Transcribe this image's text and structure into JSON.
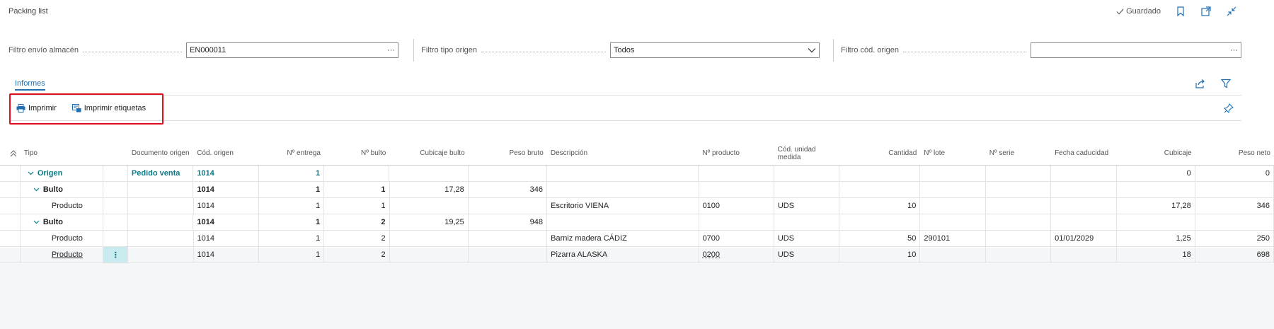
{
  "page": {
    "title": "Packing list",
    "saved_label": "Guardado"
  },
  "filters": [
    {
      "label": "Filtro envío almacén",
      "value": "EN000011",
      "kind": "lookup"
    },
    {
      "label": "Filtro tipo origen",
      "value": "Todos",
      "kind": "select"
    },
    {
      "label": "Filtro cód. origen",
      "value": "",
      "kind": "lookup"
    }
  ],
  "tabs": {
    "informes": "Informes"
  },
  "actions": {
    "print": "Imprimir",
    "print_labels": "Imprimir etiquetas"
  },
  "table": {
    "columns": [
      "Tipo",
      "Documento origen",
      "Cód. origen",
      "Nº entrega",
      "Nº bulto",
      "Cubicaje bulto",
      "Peso bruto",
      "Descripción",
      "Nº producto",
      "Cód. unidad medida",
      "Cantidad",
      "Nº lote",
      "Nº serie",
      "Fecha caducidad",
      "Cubicaje",
      "Peso neto"
    ],
    "rows": [
      {
        "level": 0,
        "tipo": "Origen",
        "doc": "Pedido venta",
        "cod": "1014",
        "entrega": "1",
        "bulto": "",
        "cub_bulto": "",
        "peso_bruto": "",
        "desc": "",
        "producto": "",
        "unidad": "",
        "cantidad": "",
        "lote": "",
        "serie": "",
        "caducidad": "",
        "cubicaje": "0",
        "peso_neto": "0"
      },
      {
        "level": 1,
        "tipo": "Bulto",
        "doc": "",
        "cod": "1014",
        "entrega": "1",
        "bulto": "1",
        "cub_bulto": "17,28",
        "peso_bruto": "346",
        "desc": "",
        "producto": "",
        "unidad": "",
        "cantidad": "",
        "lote": "",
        "serie": "",
        "caducidad": "",
        "cubicaje": "",
        "peso_neto": ""
      },
      {
        "level": 2,
        "tipo": "Producto",
        "doc": "",
        "cod": "1014",
        "entrega": "1",
        "bulto": "1",
        "cub_bulto": "",
        "peso_bruto": "",
        "desc": "Escritorio VIENA",
        "producto": "0100",
        "unidad": "UDS",
        "cantidad": "10",
        "lote": "",
        "serie": "",
        "caducidad": "",
        "cubicaje": "17,28",
        "peso_neto": "346"
      },
      {
        "level": 1,
        "tipo": "Bulto",
        "doc": "",
        "cod": "1014",
        "entrega": "1",
        "bulto": "2",
        "cub_bulto": "19,25",
        "peso_bruto": "948",
        "desc": "",
        "producto": "",
        "unidad": "",
        "cantidad": "",
        "lote": "",
        "serie": "",
        "caducidad": "",
        "cubicaje": "",
        "peso_neto": ""
      },
      {
        "level": 2,
        "tipo": "Producto",
        "doc": "",
        "cod": "1014",
        "entrega": "1",
        "bulto": "2",
        "cub_bulto": "",
        "peso_bruto": "",
        "desc": "Barniz madera CÁDIZ",
        "producto": "0700",
        "unidad": "UDS",
        "cantidad": "50",
        "lote": "290101",
        "serie": "",
        "caducidad": "01/01/2029",
        "cubicaje": "1,25",
        "peso_neto": "250"
      },
      {
        "level": 2,
        "tipo": "Producto",
        "doc": "",
        "cod": "1014",
        "entrega": "1",
        "bulto": "2",
        "cub_bulto": "",
        "peso_bruto": "",
        "desc": "Pizarra ALASKA",
        "producto": "0200",
        "unidad": "UDS",
        "cantidad": "10",
        "lote": "",
        "serie": "",
        "caducidad": "",
        "cubicaje": "18",
        "peso_neto": "698",
        "selected": true
      }
    ]
  },
  "colors": {
    "accent": "#0a7a86",
    "link": "#1f6fb2",
    "highlight": "#e0101d",
    "selected": "#c9ebef"
  }
}
